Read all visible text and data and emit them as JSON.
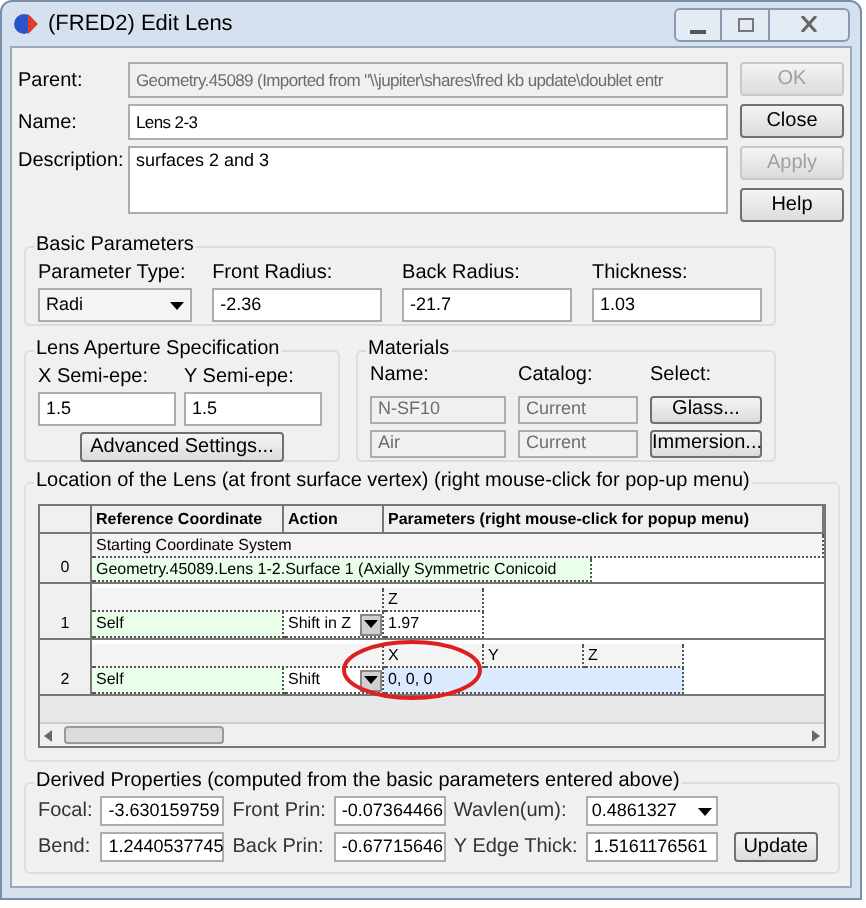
{
  "window": {
    "title": "(FRED2) Edit Lens"
  },
  "fields": [
    {
      "label": "Parent:",
      "value": "Geometry.45089 (Imported from \"\\\\jupiter\\shares\\fred kb update\\doublet entr",
      "disabled": true
    },
    {
      "label": "Name:",
      "value": "Lens 2-3",
      "disabled": false
    }
  ],
  "description": {
    "label": "Description:",
    "value": "surfaces 2 and 3"
  },
  "buttons": [
    {
      "label": "OK",
      "disabled": true
    },
    {
      "label": "Close",
      "disabled": false
    },
    {
      "label": "Apply",
      "disabled": true
    },
    {
      "label": "Help",
      "disabled": false
    }
  ],
  "basic_parameters": {
    "title": "Basic Parameters",
    "parameter_type": {
      "label": "Parameter Type:",
      "value": "Radi"
    },
    "fields": [
      {
        "label": "Front Radius:",
        "value": "-2.36"
      },
      {
        "label": "Back Radius:",
        "value": "-21.7"
      },
      {
        "label": "Thickness:",
        "value": "1.03"
      }
    ]
  },
  "aperture": {
    "title": "Lens Aperture Specification",
    "fields": [
      {
        "label": "X Semi-epe:",
        "value": "1.5"
      },
      {
        "label": "Y Semi-epe:",
        "value": "1.5"
      }
    ],
    "button": "Advanced Settings..."
  },
  "materials": {
    "title": "Materials",
    "headers": [
      "Name:",
      "Catalog:",
      "Select:"
    ],
    "rows": [
      {
        "name": "N-SF10",
        "catalog": "Current",
        "button": "Glass..."
      },
      {
        "name": "Air",
        "catalog": "Current",
        "button": "Immersion..."
      }
    ]
  },
  "location": {
    "title": "Location of the Lens (at front surface vertex)   (right mouse-click for pop-up menu)",
    "columns": [
      "Reference Coordinate",
      "Action",
      "Parameters (right mouse-click for popup menu)"
    ],
    "rows": [
      {
        "index": "0",
        "kind": "system",
        "lines": [
          "Starting Coordinate System",
          "Geometry.45089.Lens 1-2.Surface 1 (Axially Symmetric Conicoid"
        ]
      },
      {
        "index": "1",
        "kind": "shift",
        "reference": "Self",
        "action": "Shift in Z",
        "param_labels": [
          "Z"
        ],
        "params": "1.97",
        "selected": false
      },
      {
        "index": "2",
        "kind": "shift",
        "reference": "Self",
        "action": "Shift",
        "param_labels": [
          "X",
          "Y",
          "Z"
        ],
        "params": "0, 0, 0",
        "selected": true
      }
    ]
  },
  "derived": {
    "title": "Derived Properties (computed from the basic parameters entered above)",
    "rows": [
      [
        {
          "label": "Focal:",
          "value": "-3.630159759"
        },
        {
          "label": "Front Prin:",
          "value": "-0.07364466"
        },
        {
          "label": "Wavlen(um):",
          "value": "0.4861327",
          "kind": "dropdown"
        }
      ],
      [
        {
          "label": "Bend:",
          "value": "1.2440537745"
        },
        {
          "label": "Back Prin:",
          "value": "-0.67715646"
        },
        {
          "label": "Y Edge Thick:",
          "value": "1.5161176561"
        }
      ]
    ],
    "button": "Update"
  }
}
